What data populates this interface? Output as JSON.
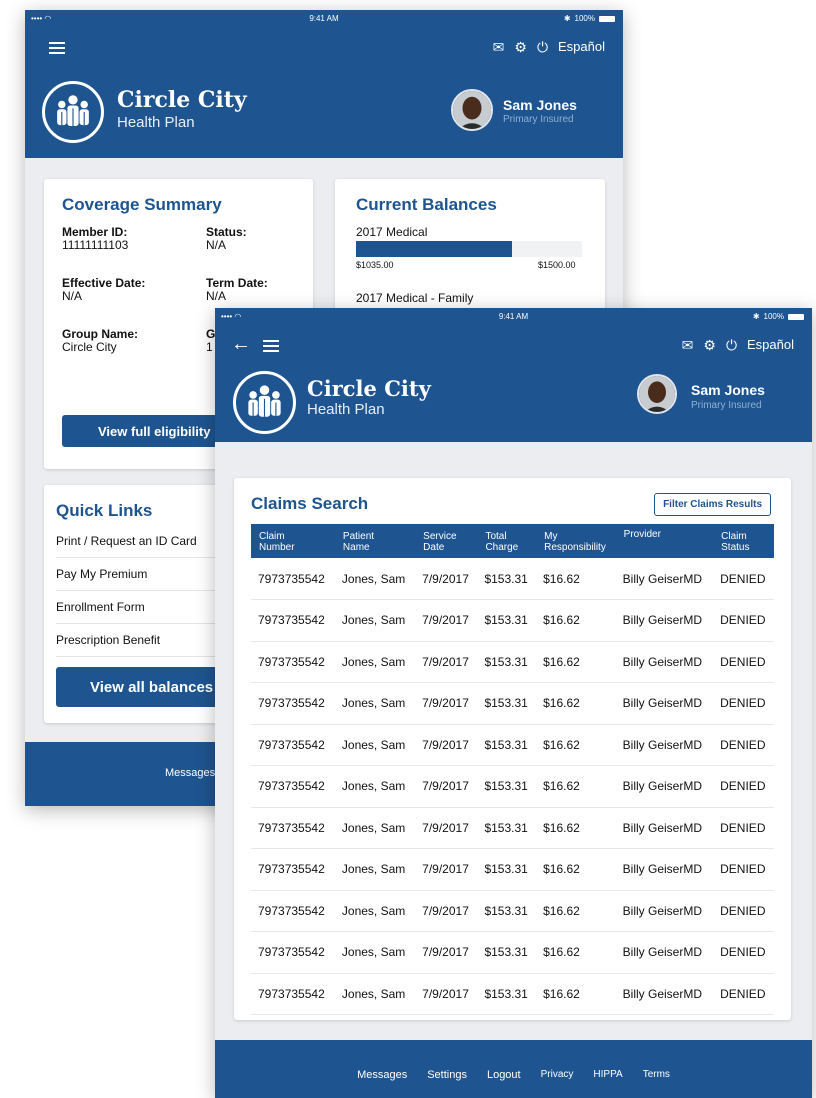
{
  "status_bar": {
    "signal": "•••• ◠",
    "time": "9:41 AM",
    "bluetooth": "✱",
    "battery_text": "100%"
  },
  "nav": {
    "language_label": "Español"
  },
  "brand": {
    "name": "Circle City",
    "sub": "Health Plan"
  },
  "user": {
    "name": "Sam Jones",
    "role": "Primary Insured"
  },
  "coverage": {
    "title": "Coverage Summary",
    "member_id_label": "Member ID:",
    "member_id": "11111111103",
    "status_label": "Status:",
    "status": "N/A",
    "effective_label": "Effective Date:",
    "effective": "N/A",
    "term_label": "Term Date:",
    "term": "N/A",
    "group_label": "Group Name:",
    "group": "Circle City",
    "group_no_label": "G",
    "group_no": "1",
    "button": "View full eligibility"
  },
  "balances": {
    "title": "Current Balances",
    "items": [
      {
        "label": "2017 Medical",
        "spent": "$1035.00",
        "limit": "$1500.00",
        "fraction": 0.69
      },
      {
        "label": "2017 Medical - Family"
      }
    ]
  },
  "quick_links": {
    "title": "Quick Links",
    "items": [
      "Print / Request an ID Card",
      "Pay My Premium",
      "Enrollment Form",
      "Prescription Benefit"
    ],
    "button": "View all balances"
  },
  "back_footer": {
    "messages": "Messages"
  },
  "claims": {
    "title": "Claims Search",
    "filter_button": "Filter Claims Results",
    "columns": [
      {
        "line1": "Claim",
        "line2": "Number"
      },
      {
        "line1": "Patient",
        "line2": "Name"
      },
      {
        "line1": "Service",
        "line2": "Date"
      },
      {
        "line1": "Total",
        "line2": "Charge"
      },
      {
        "line1": "My",
        "line2": "Responsibility"
      },
      {
        "line1": "Provider",
        "line2": ""
      },
      {
        "line1": "Claim",
        "line2": "Status"
      }
    ],
    "rows": [
      [
        "7973735542",
        "Jones, Sam",
        "7/9/2017",
        "$153.31",
        "$16.62",
        "Billy GeiserMD",
        "DENIED"
      ],
      [
        "7973735542",
        "Jones, Sam",
        "7/9/2017",
        "$153.31",
        "$16.62",
        "Billy GeiserMD",
        "DENIED"
      ],
      [
        "7973735542",
        "Jones, Sam",
        "7/9/2017",
        "$153.31",
        "$16.62",
        "Billy GeiserMD",
        "DENIED"
      ],
      [
        "7973735542",
        "Jones, Sam",
        "7/9/2017",
        "$153.31",
        "$16.62",
        "Billy GeiserMD",
        "DENIED"
      ],
      [
        "7973735542",
        "Jones, Sam",
        "7/9/2017",
        "$153.31",
        "$16.62",
        "Billy GeiserMD",
        "DENIED"
      ],
      [
        "7973735542",
        "Jones, Sam",
        "7/9/2017",
        "$153.31",
        "$16.62",
        "Billy GeiserMD",
        "DENIED"
      ],
      [
        "7973735542",
        "Jones, Sam",
        "7/9/2017",
        "$153.31",
        "$16.62",
        "Billy GeiserMD",
        "DENIED"
      ],
      [
        "7973735542",
        "Jones, Sam",
        "7/9/2017",
        "$153.31",
        "$16.62",
        "Billy GeiserMD",
        "DENIED"
      ],
      [
        "7973735542",
        "Jones, Sam",
        "7/9/2017",
        "$153.31",
        "$16.62",
        "Billy GeiserMD",
        "DENIED"
      ],
      [
        "7973735542",
        "Jones, Sam",
        "7/9/2017",
        "$153.31",
        "$16.62",
        "Billy GeiserMD",
        "DENIED"
      ],
      [
        "7973735542",
        "Jones, Sam",
        "7/9/2017",
        "$153.31",
        "$16.62",
        "Billy GeiserMD",
        "DENIED"
      ]
    ]
  },
  "footer": {
    "links": [
      "Messages",
      "Settings",
      "Logout",
      "Privacy",
      "HIPPA",
      "Terms"
    ]
  },
  "icons": {
    "mail": "mail-icon",
    "settings": "gear-icon",
    "power": "power-icon",
    "menu": "hamburger-icon",
    "back": "back-arrow-icon"
  },
  "colors": {
    "brand": "#1e548f",
    "background": "#ebedf0",
    "muted_text": "#8fb0d5"
  }
}
